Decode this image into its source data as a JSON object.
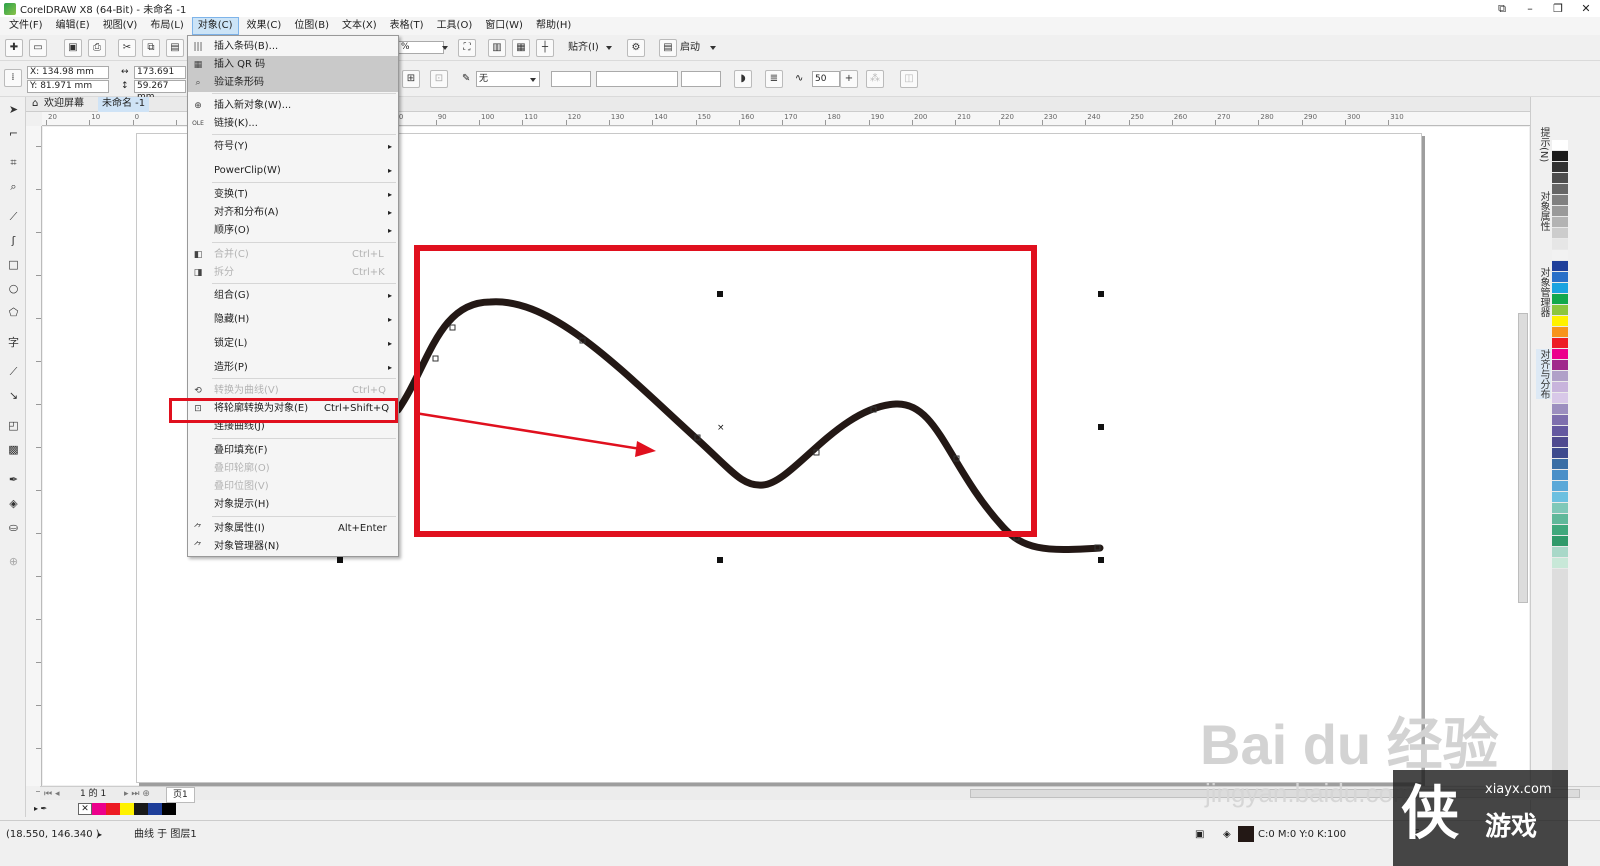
{
  "app": {
    "title": "CorelDRAW X8 (64-Bit) - 未命名 -1",
    "window_buttons": [
      "⧉",
      "–",
      "❐",
      "✕"
    ]
  },
  "menubar": {
    "items": [
      "文件(F)",
      "编辑(E)",
      "视图(V)",
      "布局(L)",
      "对象(C)",
      "效果(C)",
      "位图(B)",
      "文本(X)",
      "表格(T)",
      "工具(O)",
      "窗口(W)",
      "帮助(H)"
    ],
    "active_index": 4
  },
  "toolbar": {
    "zoom_value": "%",
    "snap_label": "贴齐(I)",
    "launch_label": "启动",
    "x_value": "X: 134.98 mm",
    "y_value": "Y: 81.971 mm",
    "width_value": "173.691 mm",
    "height_value": "59.267 mm",
    "fill_value": "无",
    "smooth_value": "50"
  },
  "tabs": {
    "welcome": "欢迎屏幕",
    "document": "未命名 -1"
  },
  "rulers": {
    "h_ticks": [
      "20",
      "10",
      "0",
      "",
      "",
      "",
      "",
      "70",
      "80",
      "90",
      "100",
      "110",
      "120",
      "130",
      "140",
      "150",
      "160",
      "170",
      "180",
      "190",
      "200",
      "210",
      "220",
      "230",
      "240",
      "250",
      "260",
      "270",
      "280",
      "290",
      "300",
      "310"
    ]
  },
  "object_menu": {
    "items": [
      {
        "label": "插入条码(B)...",
        "shortcut": "",
        "submenu": false,
        "state": "normal",
        "icon": "barcode-icon"
      },
      {
        "label": "插入 QR 码",
        "shortcut": "",
        "submenu": false,
        "state": "highlighted",
        "icon": "qr-icon"
      },
      {
        "label": "验证条形码",
        "shortcut": "",
        "submenu": false,
        "state": "highlighted",
        "icon": "verify-barcode-icon"
      },
      {
        "label": "插入新对象(W)...",
        "shortcut": "",
        "submenu": false,
        "state": "normal",
        "icon": "new-object-icon"
      },
      {
        "label": "链接(K)...",
        "shortcut": "",
        "submenu": false,
        "state": "normal",
        "icon": "ole-link-icon"
      },
      {
        "label": "符号(Y)",
        "shortcut": "",
        "submenu": true,
        "state": "normal",
        "icon": ""
      },
      {
        "label": "PowerClip(W)",
        "shortcut": "",
        "submenu": true,
        "state": "normal",
        "icon": ""
      },
      {
        "label": "变换(T)",
        "shortcut": "",
        "submenu": true,
        "state": "normal",
        "icon": ""
      },
      {
        "label": "对齐和分布(A)",
        "shortcut": "",
        "submenu": true,
        "state": "normal",
        "icon": ""
      },
      {
        "label": "顺序(O)",
        "shortcut": "",
        "submenu": true,
        "state": "normal",
        "icon": ""
      },
      {
        "label": "合并(C)",
        "shortcut": "Ctrl+L",
        "submenu": false,
        "state": "disabled",
        "icon": "combine-icon"
      },
      {
        "label": "拆分",
        "shortcut": "Ctrl+K",
        "submenu": false,
        "state": "disabled",
        "icon": "break-apart-icon"
      },
      {
        "label": "组合(G)",
        "shortcut": "",
        "submenu": true,
        "state": "normal",
        "icon": ""
      },
      {
        "label": "隐藏(H)",
        "shortcut": "",
        "submenu": true,
        "state": "normal",
        "icon": ""
      },
      {
        "label": "锁定(L)",
        "shortcut": "",
        "submenu": true,
        "state": "normal",
        "icon": ""
      },
      {
        "label": "造形(P)",
        "shortcut": "",
        "submenu": true,
        "state": "normal",
        "icon": ""
      },
      {
        "label": "转换为曲线(V)",
        "shortcut": "Ctrl+Q",
        "submenu": false,
        "state": "disabled",
        "icon": "convert-curves-icon"
      },
      {
        "label": "将轮廓转换为对象(E)",
        "shortcut": "Ctrl+Shift+Q",
        "submenu": false,
        "state": "normal",
        "icon": "outline-to-object-icon"
      },
      {
        "label": "连接曲线(J)",
        "shortcut": "",
        "submenu": false,
        "state": "normal",
        "icon": ""
      },
      {
        "label": "叠印填充(F)",
        "shortcut": "",
        "submenu": false,
        "state": "normal",
        "icon": ""
      },
      {
        "label": "叠印轮廓(O)",
        "shortcut": "",
        "submenu": false,
        "state": "disabled",
        "icon": ""
      },
      {
        "label": "叠印位图(V)",
        "shortcut": "",
        "submenu": false,
        "state": "disabled",
        "icon": ""
      },
      {
        "label": "对象提示(H)",
        "shortcut": "",
        "submenu": false,
        "state": "normal",
        "icon": ""
      },
      {
        "label": "对象属性(I)",
        "shortcut": "Alt+Enter",
        "submenu": false,
        "state": "normal",
        "icon": "properties-icon"
      },
      {
        "label": "对象管理器(N)",
        "shortcut": "",
        "submenu": false,
        "state": "normal",
        "icon": "object-manager-icon"
      }
    ]
  },
  "docker": {
    "labels": [
      "提示(N)",
      "对象属性",
      "对象管理器",
      "对齐与分布"
    ]
  },
  "pagebar": {
    "page_info": "1 的 1",
    "page_tab": "页1"
  },
  "statusbar": {
    "coords": "(18.550, 146.340 )",
    "object_info": "曲线 于 图层1",
    "color_info": "C:0 M:0 Y:0 K:100",
    "fill_none": "无"
  },
  "palette_colors": [
    "#ffffff",
    "#1a1a1a",
    "#333333",
    "#4d4d4d",
    "#666666",
    "#808080",
    "#999999",
    "#b3b3b3",
    "#cccccc",
    "#e6e6e6",
    "#f2f2f2",
    "#1f3f9a",
    "#2a70c8",
    "#1aa3e0",
    "#12a84c",
    "#8cc63f",
    "#fff200",
    "#f7941d",
    "#ed1c24",
    "#ec008c",
    "#a0288c",
    "#b0a0c8",
    "#c8b4dc",
    "#d8c8e8",
    "#9c8fbf",
    "#7e6fae",
    "#6458a0",
    "#4f4a8f",
    "#3e4b8e",
    "#3a6ea5",
    "#4a8fc8",
    "#5aa8d8",
    "#6cc0e0",
    "#7fc8b8",
    "#5fb89a",
    "#3fa87c",
    "#2f9a6a",
    "#a8d8c8",
    "#c8e8d8"
  ],
  "doc_palette": [
    "#ffffff",
    "#ec008c",
    "#ed1c24",
    "#fff200",
    "#1a1a1a",
    "#1f3f9a",
    "#000000"
  ],
  "watermark": {
    "baidu": "Bai du 经验",
    "url": "jingyan.baidu.com",
    "site": "xiayx.com",
    "game": "游戏"
  },
  "colors": {
    "annotation_red": "#e0101e",
    "curve": "#231815",
    "menu_highlight": "#c9c9c9"
  }
}
